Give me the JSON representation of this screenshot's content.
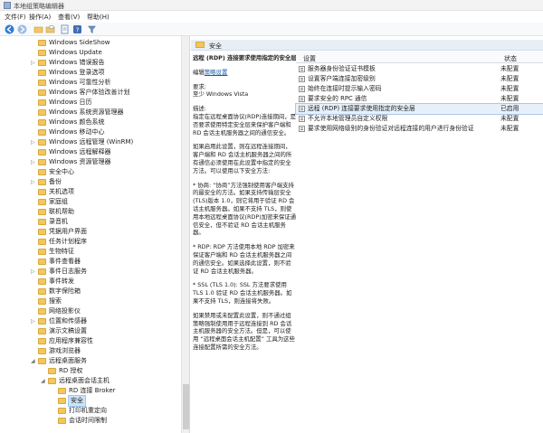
{
  "window": {
    "title": "本地组策略编辑器"
  },
  "menu": [
    "文件(F)",
    "操作(A)",
    "查看(V)",
    "帮助(H)"
  ],
  "toolbar": {
    "icons": [
      "back-icon",
      "forward-icon",
      "up-folder-icon",
      "folder-view-icon",
      "properties-icon",
      "help-icon",
      "filter-icon"
    ]
  },
  "tree": {
    "items": [
      {
        "label": "Windows SideShow",
        "expandable": false,
        "level": 0
      },
      {
        "label": "Windows Update",
        "expandable": false,
        "level": 0
      },
      {
        "label": "Windows 错误报告",
        "expandable": true,
        "level": 0
      },
      {
        "label": "Windows 登录选项",
        "expandable": false,
        "level": 0
      },
      {
        "label": "Windows 可靠性分析",
        "expandable": false,
        "level": 0
      },
      {
        "label": "Windows 客户体验改善计划",
        "expandable": false,
        "level": 0
      },
      {
        "label": "Windows 日历",
        "expandable": false,
        "level": 0
      },
      {
        "label": "Windows 系统资源管理器",
        "expandable": false,
        "level": 0
      },
      {
        "label": "Windows 颜色系统",
        "expandable": false,
        "level": 0
      },
      {
        "label": "Windows 移动中心",
        "expandable": false,
        "level": 0
      },
      {
        "label": "Windows 远程管理 (WinRM)",
        "expandable": true,
        "level": 0
      },
      {
        "label": "Windows 远程解释器",
        "expandable": false,
        "level": 0
      },
      {
        "label": "Windows 资源管理器",
        "expandable": true,
        "level": 0
      },
      {
        "label": "安全中心",
        "expandable": false,
        "level": 0
      },
      {
        "label": "备份",
        "expandable": true,
        "level": 0
      },
      {
        "label": "关机选项",
        "expandable": false,
        "level": 0
      },
      {
        "label": "家庭组",
        "expandable": false,
        "level": 0
      },
      {
        "label": "联机帮助",
        "expandable": false,
        "level": 0
      },
      {
        "label": "录音机",
        "expandable": false,
        "level": 0
      },
      {
        "label": "凭据用户界面",
        "expandable": false,
        "level": 0
      },
      {
        "label": "任务计划程序",
        "expandable": false,
        "level": 0
      },
      {
        "label": "生物特征",
        "expandable": false,
        "level": 0
      },
      {
        "label": "事件查看器",
        "expandable": false,
        "level": 0
      },
      {
        "label": "事件日志服务",
        "expandable": true,
        "level": 0
      },
      {
        "label": "事件转发",
        "expandable": false,
        "level": 0
      },
      {
        "label": "数字保险箱",
        "expandable": false,
        "level": 0
      },
      {
        "label": "搜索",
        "expandable": false,
        "level": 0
      },
      {
        "label": "网络投影仪",
        "expandable": false,
        "level": 0
      },
      {
        "label": "位置和传感器",
        "expandable": true,
        "level": 0
      },
      {
        "label": "演示文稿设置",
        "expandable": false,
        "level": 0
      },
      {
        "label": "应用程序兼容性",
        "expandable": false,
        "level": 0
      },
      {
        "label": "游戏浏览器",
        "expandable": false,
        "level": 0
      },
      {
        "label": "远程桌面服务",
        "expandable": true,
        "expanded": true,
        "level": 0
      },
      {
        "label": "RD 授权",
        "expandable": false,
        "level": 1
      },
      {
        "label": "远程桌面会话主机",
        "expandable": true,
        "expanded": true,
        "level": 1
      },
      {
        "label": "RD 连接 Broker",
        "expandable": false,
        "level": 2
      },
      {
        "label": "安全",
        "expandable": false,
        "level": 2,
        "selected": true
      },
      {
        "label": "打印机重定向",
        "expandable": false,
        "level": 2
      },
      {
        "label": "会话时间限制",
        "expandable": false,
        "level": 2
      }
    ]
  },
  "path": {
    "label": "安全"
  },
  "description": {
    "title": "远程 (RDP) 连接要求使用指定的安全层",
    "edit_prefix": "编辑",
    "edit_link": "策略设置",
    "req_label": "要求:",
    "req_value": "至少 Windows Vista",
    "desc_label": "描述:",
    "paragraphs": [
      "指定在远程桌面协议(RDP)连接期间，是否要求使用特定安全层来保护客户端和 RD 会话主机服务器之间的通信安全。",
      "如果启用此设置，则在远程连接期间，客户端和 RD 会话主机服务器之间的所有通信必须使用在此设置中指定的安全方法。可以使用以下安全方法:",
      "* 协商: “协商”方法强制使用客户端支持的最安全的方法。如果支持传输层安全(TLS)版本 1.0，则它将用于验证 RD 会话主机服务器。如果不支持 TLS，则使用本地远程桌面协议(RDP)加密来保证通信安全，但不验证 RD 会话主机服务器。",
      "* RDP: RDP 方法使用本地 RDP 加密来保证客户端和 RD 会话主机服务器之间的通信安全。如果选择此设置，则不验证 RD 会话主机服务器。",
      "* SSL (TLS 1.0): SSL 方法要求使用 TLS 1.0 验证 RD 会话主机服务器。如果不支持 TLS，则连接将失败。",
      "如果禁用或未配置此设置，则不通过组策略强制使用用于远程连接到 RD 会话主机服务器的安全方法。但是，可以使用 “远程桌面会话主机配置” 工具为这些连接配置所需的安全方法。"
    ]
  },
  "list": {
    "headers": {
      "setting": "设置",
      "state": "状态"
    },
    "rows": [
      {
        "name": "服务器身份验证证书模板",
        "state": "未配置"
      },
      {
        "name": "设置客户端连接加密级别",
        "state": "未配置"
      },
      {
        "name": "始终在连接时提示输入密码",
        "state": "未配置"
      },
      {
        "name": "要求安全的 RPC 通信",
        "state": "未配置"
      },
      {
        "name": "远程 (RDP) 连接要求使用指定的安全层",
        "state": "已启用",
        "selected": true
      },
      {
        "name": "不允许本地管理员自定义权限",
        "state": "未配置"
      },
      {
        "name": "要求使用网络级别的身份验证对远程连接的用户进行身份验证",
        "state": "未配置"
      }
    ]
  }
}
